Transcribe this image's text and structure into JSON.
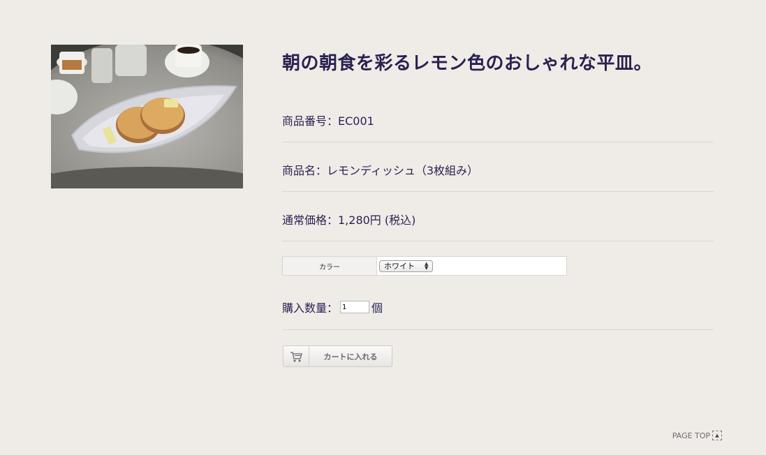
{
  "product": {
    "title": "朝の朝食を彩るレモン色のおしゃれな平皿。",
    "code_label": "商品番号：EC001",
    "name_label": "商品名：レモンディッシュ（3枚組み）",
    "price_label": "通常価格：1,280円 (税込)"
  },
  "variant": {
    "label": "カラー",
    "selected": "ホワイト"
  },
  "quantity": {
    "label": "購入数量：",
    "value": "1",
    "unit": "個"
  },
  "cart_button": {
    "label": "カートに入れる",
    "icon": "cart-icon"
  },
  "footer": {
    "page_top": "PAGE TOP"
  }
}
